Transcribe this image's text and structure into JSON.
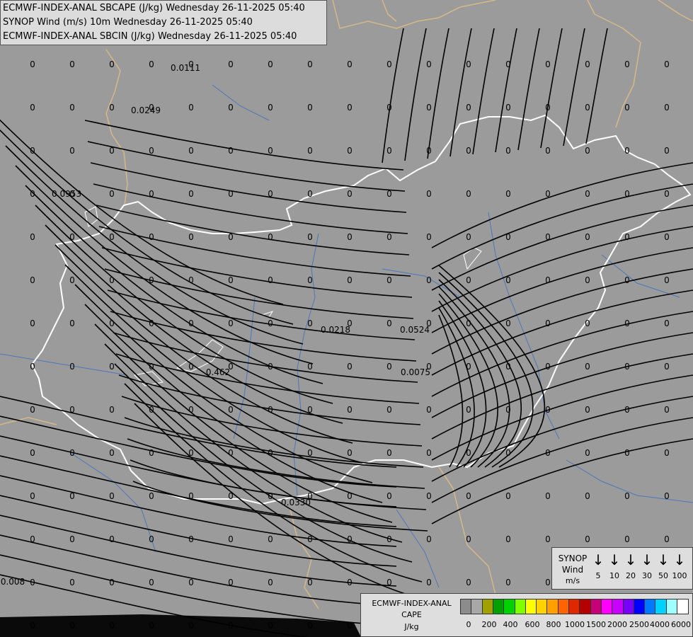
{
  "header": {
    "line1": "ECMWF-INDEX-ANAL SBCAPE (J/kg) Wednesday 26-11-2025 05:40",
    "line2": "SYNOP Wind (m/s) 10m Wednesday 26-11-2025 05:40",
    "line3": "ECMWF-INDEX-ANAL SBCIN (J/kg) Wednesday 26-11-2025 05:40"
  },
  "colors": {
    "background": "#9b9b9b",
    "border": "#ffffff",
    "neighbour_border": "#d8b888",
    "river": "#4a78b8",
    "streamline": "#000000",
    "sea": "#000000"
  },
  "grid_values": {
    "zero": "0",
    "special": [
      "0.0111",
      "0.0249",
      "0.0953",
      "0.0218",
      "0.0524",
      "0.462",
      "0.0075",
      "0.0330",
      "0.008"
    ]
  },
  "synop_legend": {
    "title": "SYNOP",
    "subtitle": "Wind",
    "unit": "m/s",
    "speeds": [
      "5",
      "10",
      "20",
      "30",
      "50",
      "100"
    ],
    "icon": "wind-barb-arrow"
  },
  "cape_legend": {
    "title1": "ECMWF-INDEX-ANAL",
    "title2": "CAPE",
    "unit": "J/kg",
    "swatches": [
      "#8c8c8c",
      "#a8a8a8",
      "#a0a000",
      "#00a000",
      "#00d200",
      "#80ff00",
      "#ffff00",
      "#ffd200",
      "#ffa000",
      "#ff6400",
      "#e02800",
      "#b40000",
      "#c80078",
      "#ff00ff",
      "#c800ff",
      "#7800ff",
      "#0000ff",
      "#0078ff",
      "#00d2ff",
      "#a0ffff",
      "#ffffff"
    ],
    "ticks": [
      "0",
      "200",
      "400",
      "600",
      "800",
      "1000",
      "1500",
      "2000",
      "2500",
      "4000",
      "6000"
    ]
  }
}
